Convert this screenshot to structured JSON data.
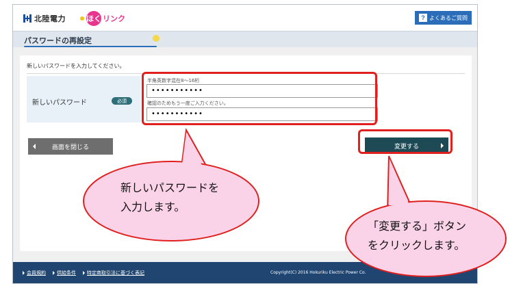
{
  "header": {
    "company_name": "北陸電力",
    "sub_brand_mark": "ほく",
    "sub_brand_text": "リンク",
    "faq_icon": "?",
    "faq_label": "よくあるご質問"
  },
  "page": {
    "title": "パスワードの再設定",
    "instruction": "新しいパスワードを入力してください。"
  },
  "form": {
    "field_label": "新しいパスワード",
    "required_badge": "必須",
    "hint_format": "半角英数字混在8～16桁",
    "password_value": "•••••••••••",
    "hint_confirm": "確認のためもう一度ご入力ください。",
    "confirm_value": "•••••••••••"
  },
  "buttons": {
    "close_label": "画面を閉じる",
    "change_label": "変更する"
  },
  "footer": {
    "links": [
      "会員規約",
      "供給条件",
      "特定商取引法に基づく表記"
    ],
    "copyright": "Copyright(C) 2016 Hokuriku Electric Power Co."
  },
  "callouts": {
    "left_line1": "新しいパスワードを",
    "left_line2": "入力します。",
    "right_line1": "「変更する」ボタン",
    "right_line2": "をクリックします。"
  },
  "colors": {
    "accent_blue": "#2b6db8",
    "footer_navy": "#1f4570",
    "highlight_red": "#e0201e",
    "callout_pink": "#fbd3e8"
  }
}
